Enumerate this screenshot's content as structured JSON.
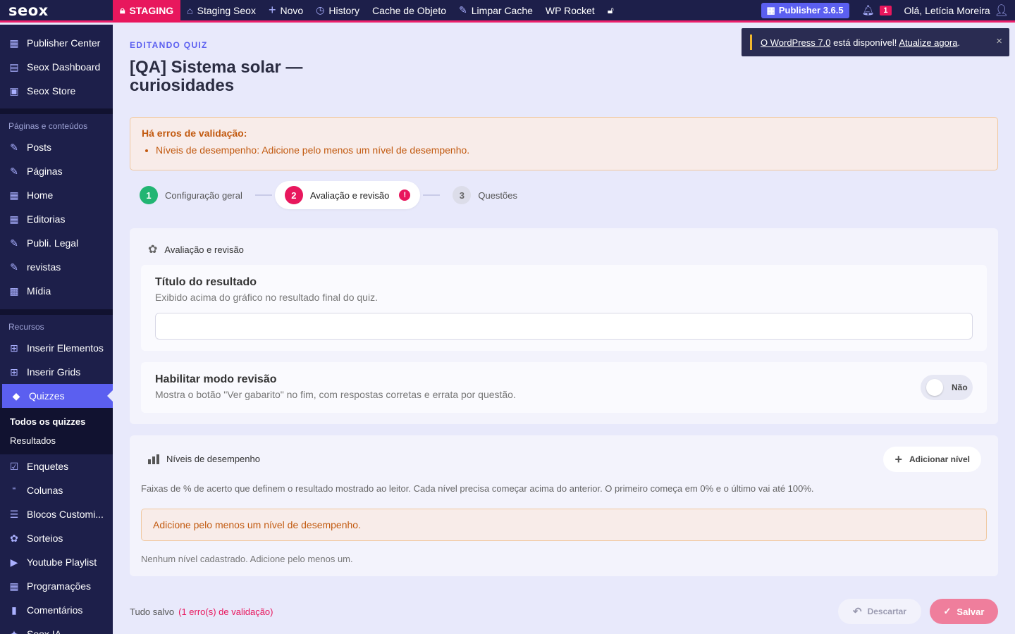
{
  "adminbar": {
    "logo": "seox",
    "staging": "STAGING",
    "site": "Staging Seox",
    "new": "Novo",
    "history": "History",
    "object_cache": "Cache de Objeto",
    "clear_cache": "Limpar Cache",
    "wp_rocket": "WP Rocket",
    "publisher": "Publisher 3.6.5",
    "notif_count": "1",
    "greeting": "Olá, Letícia Moreira"
  },
  "sidebar": {
    "top": [
      "Publisher Center",
      "Seox Dashboard",
      "Seox Store"
    ],
    "section1": "Páginas e conteúdos",
    "content": [
      "Posts",
      "Páginas",
      "Home",
      "Editorias",
      "Publi. Legal",
      "revistas",
      "Mídia"
    ],
    "section2": "Recursos",
    "resources": [
      "Inserir Elementos",
      "Inserir Grids",
      "Quizzes"
    ],
    "quiz_sub": [
      "Todos os quizzes",
      "Resultados"
    ],
    "more": [
      "Enquetes",
      "Colunas",
      "Blocos Customi...",
      "Sorteios",
      "Youtube Playlist",
      "Programações",
      "Comentários",
      "Seox IA"
    ]
  },
  "page": {
    "kicker": "EDITANDO QUIZ",
    "title": "[QA] Sistema solar — curiosidades"
  },
  "toast": {
    "link1": "O WordPress 7.0",
    "text": " está disponível! ",
    "link2": "Atualize agora",
    "dot": ".",
    "close": "×"
  },
  "errors": {
    "heading": "Há erros de validação:",
    "items": [
      "Níveis de desempenho: Adicione pelo menos um nível de desempenho."
    ]
  },
  "steps": [
    {
      "num": "1",
      "label": "Configuração geral"
    },
    {
      "num": "2",
      "label": "Avaliação e revisão"
    },
    {
      "num": "3",
      "label": "Questões"
    }
  ],
  "review_card": {
    "heading": "Avaliação e revisão",
    "result_title": "Título do resultado",
    "result_desc": "Exibido acima do gráfico no resultado final do quiz.",
    "result_value": "",
    "review_title": "Habilitar modo revisão",
    "review_desc": "Mostra o botão \"Ver gabarito\" no fim, com respostas corretas e errata por questão.",
    "toggle_label": "Não"
  },
  "levels_card": {
    "heading": "Níveis de desempenho",
    "add_button": "Adicionar nível",
    "desc": "Faixas de % de acerto que definem o resultado mostrado ao leitor. Cada nível precisa começar acima do anterior. O primeiro começa em 0% e o último vai até 100%.",
    "warning": "Adicione pelo menos um nível de desempenho.",
    "empty": "Nenhum nível cadastrado. Adicione pelo menos um."
  },
  "footer": {
    "status": "Tudo salvo",
    "errors": "(1 erro(s) de validação)",
    "discard": "Descartar",
    "save": "Salvar"
  },
  "colors": {
    "accent": "#5b5ff0",
    "brand_pink": "#e8175d",
    "sidebar_bg": "#1d1f4a",
    "success": "#22b573"
  }
}
